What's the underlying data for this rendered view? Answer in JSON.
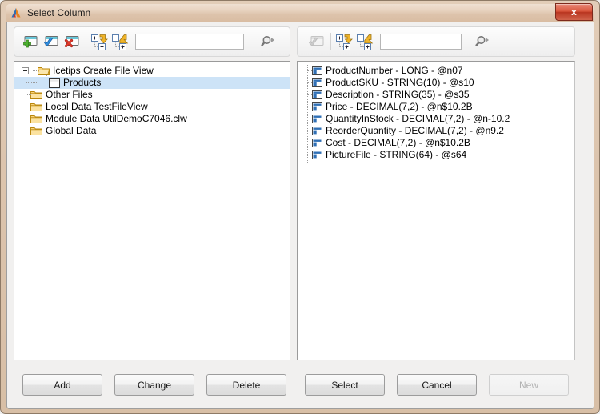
{
  "window": {
    "title": "Select Column",
    "app_icon": "clarion-triangle-icon",
    "close_label": "x"
  },
  "left_panel": {
    "toolbar": {
      "add_icon": "window-add-icon",
      "apply_icon": "window-check-icon",
      "delete_icon": "window-delete-icon",
      "expand_all_icon": "expand-all-icon",
      "collapse_all_icon": "collapse-all-icon",
      "search_value": "",
      "search_placeholder": "",
      "search_icon": "magnifier-dropdown-icon"
    },
    "tree": [
      {
        "label": "Icetips Create File View",
        "icon": "folder-open-icon",
        "depth": 0,
        "expander": "minus",
        "selected": false
      },
      {
        "label": "Products",
        "icon": "table-icon",
        "depth": 1,
        "expander": "none",
        "selected": true
      },
      {
        "label": "Other Files",
        "icon": "folder-icon",
        "depth": 0,
        "expander": "none",
        "selected": false
      },
      {
        "label": "Local Data TestFileView",
        "icon": "folder-icon",
        "depth": 0,
        "expander": "none",
        "selected": false
      },
      {
        "label": "Module Data UtilDemoC7046.clw",
        "icon": "folder-icon",
        "depth": 0,
        "expander": "none",
        "selected": false
      },
      {
        "label": "Global Data",
        "icon": "folder-icon",
        "depth": 0,
        "expander": "none",
        "selected": false
      }
    ]
  },
  "right_panel": {
    "toolbar": {
      "insert_icon": "window-insert-disabled-icon",
      "expand_all_icon": "expand-all-icon",
      "collapse_all_icon": "collapse-all-icon",
      "search_value": "",
      "search_placeholder": "",
      "search_icon": "magnifier-dropdown-icon"
    },
    "columns": [
      {
        "label": "ProductNumber  -  LONG  -  @n07",
        "icon": "column-icon"
      },
      {
        "label": "ProductSKU  -  STRING(10)  -  @s10",
        "icon": "column-icon"
      },
      {
        "label": "Description  -  STRING(35)  -  @s35",
        "icon": "column-icon"
      },
      {
        "label": "Price  -  DECIMAL(7,2)  -  @n$10.2B",
        "icon": "column-icon"
      },
      {
        "label": "QuantityInStock  -  DECIMAL(7,2)  -  @n-10.2",
        "icon": "column-icon"
      },
      {
        "label": "ReorderQuantity  -  DECIMAL(7,2)  -  @n9.2",
        "icon": "column-icon"
      },
      {
        "label": "Cost  -  DECIMAL(7,2)  -  @n$10.2B",
        "icon": "column-icon"
      },
      {
        "label": "PictureFile  -  STRING(64)  -  @s64",
        "icon": "column-icon"
      }
    ]
  },
  "buttons": {
    "add": "Add",
    "change": "Change",
    "delete": "Delete",
    "select": "Select",
    "cancel": "Cancel",
    "new": "New"
  },
  "colors": {
    "frame": "#d8bfa6",
    "selection": "#cde3f7",
    "close_button": "#c2452c",
    "folder": "#f5c462"
  }
}
